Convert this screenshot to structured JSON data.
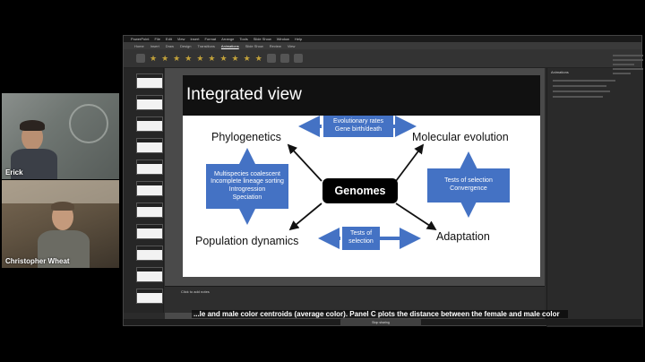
{
  "participants": [
    {
      "name": "Erick"
    },
    {
      "name": "Christopher Wheat"
    }
  ],
  "app": {
    "menu": [
      "PowerPoint",
      "File",
      "Edit",
      "View",
      "Insert",
      "Format",
      "Arrange",
      "Tools",
      "Slide Show",
      "Window",
      "Help"
    ],
    "ribbon_tabs": [
      "Home",
      "Insert",
      "Draw",
      "Design",
      "Transitions",
      "Animations",
      "Slide Show",
      "Review",
      "View"
    ],
    "active_tab": "Animations"
  },
  "slide": {
    "title": "Integrated view",
    "nodes": {
      "phylogenetics": "Phylogenetics",
      "molecular_evolution": "Molecular evolution",
      "population_dynamics": "Population dynamics",
      "adaptation": "Adaptation",
      "genomes": "Genomes"
    },
    "boxes": {
      "top": [
        "Evolutionary rates",
        "Gene birth/death"
      ],
      "left": [
        "Multispecies coalescent",
        "Incomplete lineage sorting",
        "Introgression",
        "Speciation"
      ],
      "right": [
        "Tests of selection",
        "Convergence"
      ],
      "bottom": [
        "Tests of",
        "selection"
      ]
    }
  },
  "notes_placeholder": "Click to add notes",
  "right_panel_header": "Animations",
  "caption": "...le and male color centroids (average color). Panel C plots the distance between the female and male color",
  "share_banner": "Stop sharing"
}
